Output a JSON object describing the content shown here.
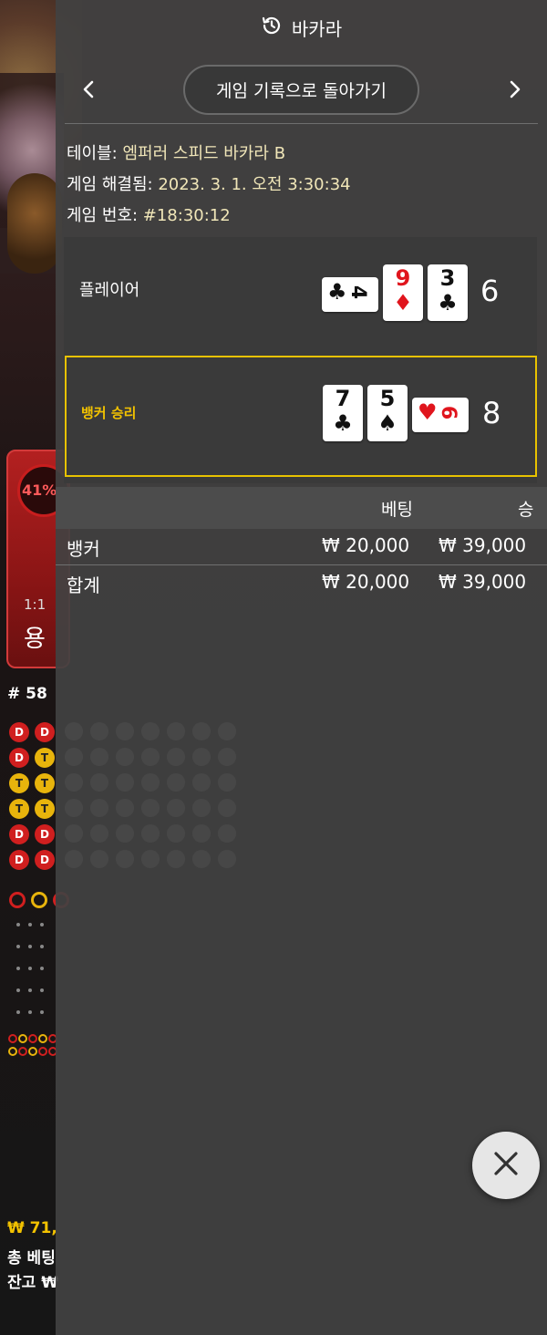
{
  "panel": {
    "title": "바카라",
    "back_label": "게임 기록으로 돌아가기"
  },
  "info": {
    "table_label": "테이블:",
    "table_value": "엠퍼러 스피드 바카라 B",
    "resolved_label": "게임 해결됨:",
    "resolved_value": "2023. 3. 1. 오전 3:30:34",
    "game_no_label": "게임 번호:",
    "game_no_value": "#18:30:12"
  },
  "hands": {
    "player": {
      "label": "플레이어",
      "score": "6",
      "cards": [
        {
          "rank": "4",
          "suit": "♣",
          "color": "black",
          "sideways": true
        },
        {
          "rank": "9",
          "suit": "♦",
          "color": "red",
          "sideways": false
        },
        {
          "rank": "3",
          "suit": "♣",
          "color": "black",
          "sideways": false
        }
      ]
    },
    "banker": {
      "label": "뱅커 승리",
      "score": "8",
      "cards": [
        {
          "rank": "7",
          "suit": "♣",
          "color": "black",
          "sideways": false
        },
        {
          "rank": "5",
          "suit": "♠",
          "color": "black",
          "sideways": false
        },
        {
          "rank": "6",
          "suit": "♥",
          "color": "red",
          "sideways": true
        }
      ]
    }
  },
  "table": {
    "headers": {
      "bet": "베팅",
      "win": "승"
    },
    "rows": [
      {
        "name": "뱅커",
        "bet": "₩ 20,000",
        "win": "₩ 39,000"
      }
    ],
    "total": {
      "name": "합계",
      "bet": "₩ 20,000",
      "win": "₩ 39,000"
    }
  },
  "background": {
    "bet_percent": "41%",
    "bet_ratio": "1:1",
    "bet_name": "용",
    "round_no": "# 58",
    "bead_rows": [
      [
        "D",
        "D"
      ],
      [
        "D",
        "T"
      ],
      [
        "T",
        "T"
      ],
      [
        "T",
        "T"
      ],
      [
        "D",
        "D"
      ],
      [
        "D",
        "D"
      ]
    ],
    "total_win": "₩ 71,",
    "total_bet_label": "총 베팅",
    "balance_label": "잔고 ₩"
  },
  "colors": {
    "accent_gold": "#e8c200",
    "dragon_red": "#d01f1f",
    "tie_yellow": "#e8b40c",
    "panel_bg": "#424242"
  },
  "icons": {
    "history": "history-icon",
    "prev": "chevron-left-icon",
    "next": "chevron-right-icon",
    "close": "close-icon"
  }
}
